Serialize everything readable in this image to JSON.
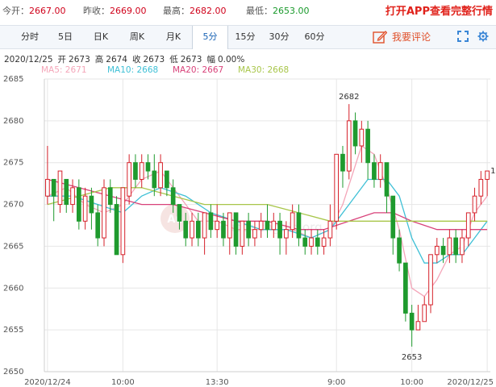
{
  "quote": {
    "open_label": "今开：",
    "open_value": "2667.00",
    "prev_close_label": "昨收：",
    "prev_close_value": "2669.00",
    "high_label": "最高：",
    "high_value": "2682.00",
    "low_label": "最低：",
    "low_value": "2653.00",
    "promo": "打开APP查看完整行情"
  },
  "tabs": [
    "分时",
    "5日",
    "日K",
    "周K",
    "月K",
    "5分",
    "15分",
    "30分",
    "60分"
  ],
  "active_tab": "5分",
  "comment_button": "我要评论",
  "info": {
    "date": "2020/12/25",
    "open_label": "开",
    "open": "2673",
    "high_label": "高",
    "high": "2674",
    "close_label": "收",
    "close": "2673",
    "low_label": "低",
    "low": "2673",
    "amp_label": "幅",
    "amp": "0.00%"
  },
  "legend": [
    {
      "label": "MA5: 2671",
      "color": "#f4a6b9"
    },
    {
      "label": "MA10: 2668",
      "color": "#3fc0d6"
    },
    {
      "label": "MA20: 2667",
      "color": "#d8427a"
    },
    {
      "label": "MA30: 2668",
      "color": "#a8c64a"
    }
  ],
  "watermark": {
    "logo": "Au",
    "url": "quote.cngold.org"
  },
  "colors": {
    "up": "#d6212a",
    "down": "#1f9a2e",
    "grid": "#e6e6e6"
  },
  "chart_data": {
    "type": "candlestick",
    "title": "",
    "xlabel": "",
    "ylabel": "",
    "ylim": [
      2650,
      2685
    ],
    "yticks": [
      2650,
      2655,
      2660,
      2665,
      2670,
      2675,
      2680,
      2685
    ],
    "xticks": [
      {
        "i": 0,
        "label": "2020/12/24"
      },
      {
        "i": 12,
        "label": "10:00"
      },
      {
        "i": 27,
        "label": "13:30"
      },
      {
        "i": 46,
        "label": "9:00"
      },
      {
        "i": 58,
        "label": "10:00"
      },
      {
        "i": 70,
        "label": "2020/12/25"
      }
    ],
    "candles": [
      [
        2671,
        2673,
        2677,
        2670
      ],
      [
        2673,
        2671,
        2673,
        2668
      ],
      [
        2670,
        2674,
        2674,
        2669
      ],
      [
        2673,
        2670,
        2673,
        2669
      ],
      [
        2670,
        2672,
        2673,
        2669
      ],
      [
        2672,
        2668,
        2673,
        2667
      ],
      [
        2668,
        2671,
        2672,
        2667
      ],
      [
        2671,
        2669,
        2672,
        2667
      ],
      [
        2669,
        2666,
        2670,
        2665
      ],
      [
        2666,
        2672,
        2673,
        2665
      ],
      [
        2672,
        2670,
        2673,
        2669
      ],
      [
        2670,
        2664,
        2671,
        2664
      ],
      [
        2664,
        2672,
        2672,
        2663
      ],
      [
        2671,
        2675,
        2676,
        2670
      ],
      [
        2675,
        2673,
        2676,
        2672
      ],
      [
        2673,
        2675,
        2676,
        2672
      ],
      [
        2675,
        2674,
        2676,
        2673
      ],
      [
        2674,
        2672,
        2676,
        2671
      ],
      [
        2672,
        2675,
        2676,
        2671
      ],
      [
        2674,
        2672,
        2674,
        2671
      ],
      [
        2672,
        2670,
        2673,
        2669
      ],
      [
        2670,
        2668,
        2670,
        2667
      ],
      [
        2668,
        2666,
        2669,
        2665
      ],
      [
        2666,
        2668,
        2669,
        2665
      ],
      [
        2668,
        2666,
        2669,
        2665
      ],
      [
        2666,
        2669,
        2669,
        2664
      ],
      [
        2669,
        2667,
        2670,
        2666
      ],
      [
        2667,
        2668,
        2670,
        2666
      ],
      [
        2668,
        2666,
        2669,
        2665
      ],
      [
        2666,
        2669,
        2669,
        2664
      ],
      [
        2669,
        2665,
        2669,
        2664
      ],
      [
        2665,
        2668,
        2668,
        2664
      ],
      [
        2668,
        2666,
        2669,
        2665
      ],
      [
        2666,
        2667,
        2668,
        2665
      ],
      [
        2667,
        2668,
        2669,
        2666
      ],
      [
        2668,
        2667,
        2670,
        2666
      ],
      [
        2667,
        2668,
        2669,
        2666
      ],
      [
        2668,
        2666,
        2669,
        2664
      ],
      [
        2666,
        2667,
        2668,
        2664
      ],
      [
        2667,
        2669,
        2670,
        2666
      ],
      [
        2669,
        2666,
        2670,
        2665
      ],
      [
        2666,
        2665,
        2667,
        2664
      ],
      [
        2665,
        2666,
        2667,
        2664
      ],
      [
        2666,
        2665,
        2667,
        2664
      ],
      [
        2665,
        2666,
        2667,
        2664
      ],
      [
        2666,
        2668,
        2670,
        2665
      ],
      [
        2668,
        2676,
        2676,
        2667
      ],
      [
        2676,
        2674,
        2677,
        2672
      ],
      [
        2674,
        2680,
        2682,
        2673
      ],
      [
        2680,
        2677,
        2681,
        2676
      ],
      [
        2677,
        2679,
        2680,
        2675
      ],
      [
        2679,
        2675,
        2680,
        2673
      ],
      [
        2675,
        2673,
        2676,
        2672
      ],
      [
        2673,
        2675,
        2676,
        2672
      ],
      [
        2675,
        2671,
        2675,
        2669
      ],
      [
        2671,
        2666,
        2671,
        2664
      ],
      [
        2666,
        2663,
        2667,
        2662
      ],
      [
        2663,
        2657,
        2663,
        2656
      ],
      [
        2657,
        2655,
        2658,
        2653
      ],
      [
        2655,
        2656,
        2658,
        2655
      ],
      [
        2656,
        2658,
        2659,
        2656
      ],
      [
        2658,
        2664,
        2664,
        2657
      ],
      [
        2664,
        2665,
        2666,
        2663
      ],
      [
        2665,
        2664,
        2666,
        2663
      ],
      [
        2664,
        2666,
        2667,
        2663
      ],
      [
        2666,
        2664,
        2667,
        2663
      ],
      [
        2664,
        2666,
        2667,
        2663
      ],
      [
        2666,
        2669,
        2669,
        2665
      ],
      [
        2669,
        2671,
        2672,
        2668
      ],
      [
        2671,
        2673,
        2674,
        2670
      ],
      [
        2673,
        2674,
        2674,
        2671
      ]
    ],
    "annotations": [
      {
        "label": "2682",
        "i": 48,
        "value": 2682,
        "pos": "above"
      },
      {
        "label": "2653",
        "i": 58,
        "value": 2653,
        "pos": "below"
      },
      {
        "label": "1",
        "i": 70,
        "value": 2674,
        "pos": "right"
      }
    ],
    "ma": [
      {
        "name": "MA5",
        "color": "#f4a6b9",
        "points": [
          [
            0,
            2671
          ],
          [
            3,
            2672
          ],
          [
            6,
            2670
          ],
          [
            9,
            2669
          ],
          [
            12,
            2670
          ],
          [
            15,
            2673
          ],
          [
            18,
            2674
          ],
          [
            21,
            2671
          ],
          [
            24,
            2668
          ],
          [
            27,
            2668
          ],
          [
            30,
            2667
          ],
          [
            33,
            2667
          ],
          [
            36,
            2667
          ],
          [
            39,
            2667
          ],
          [
            42,
            2666
          ],
          [
            45,
            2667
          ],
          [
            47,
            2670
          ],
          [
            50,
            2677
          ],
          [
            52,
            2676
          ],
          [
            54,
            2672
          ],
          [
            56,
            2667
          ],
          [
            58,
            2660
          ],
          [
            60,
            2659
          ],
          [
            62,
            2661
          ],
          [
            64,
            2664
          ],
          [
            66,
            2665
          ],
          [
            68,
            2669
          ],
          [
            70,
            2671
          ]
        ]
      },
      {
        "name": "MA10",
        "color": "#3fc0d6",
        "points": [
          [
            0,
            2671
          ],
          [
            4,
            2671
          ],
          [
            8,
            2670
          ],
          [
            12,
            2669
          ],
          [
            15,
            2671
          ],
          [
            18,
            2672
          ],
          [
            22,
            2671
          ],
          [
            26,
            2669
          ],
          [
            30,
            2668
          ],
          [
            34,
            2667
          ],
          [
            38,
            2667
          ],
          [
            42,
            2666
          ],
          [
            45,
            2667
          ],
          [
            48,
            2670
          ],
          [
            51,
            2673
          ],
          [
            54,
            2673
          ],
          [
            56,
            2671
          ],
          [
            58,
            2666
          ],
          [
            60,
            2663
          ],
          [
            62,
            2663
          ],
          [
            64,
            2664
          ],
          [
            66,
            2664
          ],
          [
            68,
            2666
          ],
          [
            70,
            2668
          ]
        ]
      },
      {
        "name": "MA20",
        "color": "#d8427a",
        "points": [
          [
            0,
            2673
          ],
          [
            5,
            2672
          ],
          [
            10,
            2671
          ],
          [
            15,
            2670
          ],
          [
            20,
            2670
          ],
          [
            25,
            2669
          ],
          [
            30,
            2668
          ],
          [
            35,
            2668
          ],
          [
            40,
            2667
          ],
          [
            44,
            2667
          ],
          [
            48,
            2668
          ],
          [
            52,
            2669
          ],
          [
            55,
            2669
          ],
          [
            58,
            2668
          ],
          [
            62,
            2667
          ],
          [
            66,
            2667
          ],
          [
            70,
            2667
          ]
        ]
      },
      {
        "name": "MA30",
        "color": "#a8c64a",
        "points": [
          [
            0,
            2670
          ],
          [
            5,
            2671
          ],
          [
            10,
            2672
          ],
          [
            15,
            2672
          ],
          [
            20,
            2671
          ],
          [
            25,
            2670
          ],
          [
            30,
            2670
          ],
          [
            35,
            2670
          ],
          [
            40,
            2669
          ],
          [
            45,
            2668
          ],
          [
            50,
            2668
          ],
          [
            55,
            2668
          ],
          [
            60,
            2668
          ],
          [
            65,
            2668
          ],
          [
            70,
            2668
          ]
        ]
      }
    ]
  }
}
